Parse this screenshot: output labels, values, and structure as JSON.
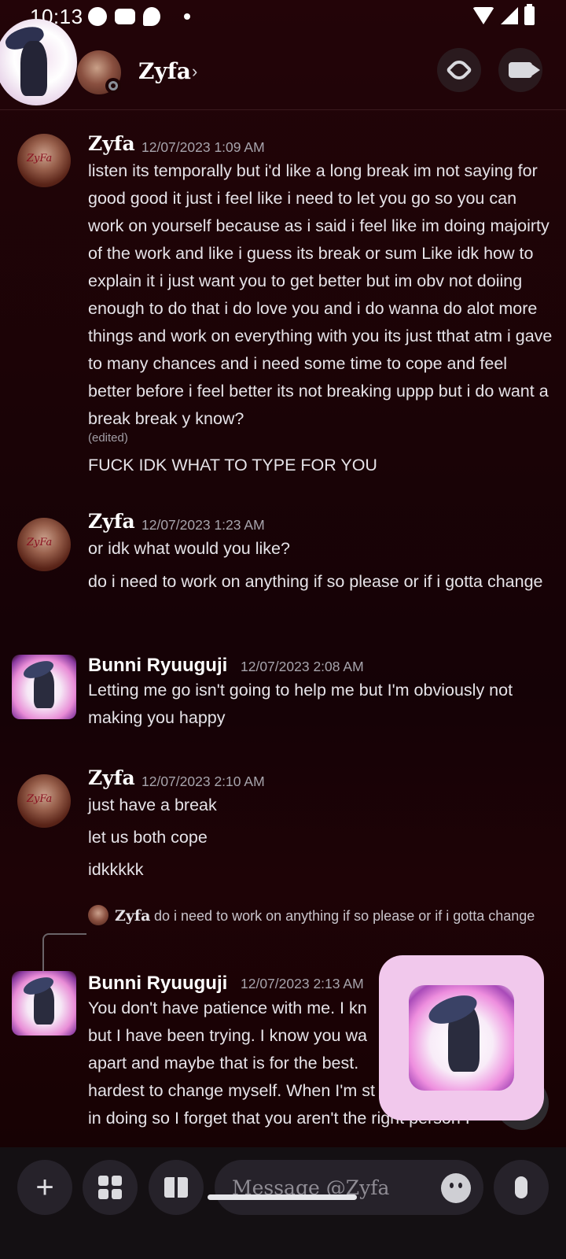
{
  "status_bar": {
    "time": "10:13"
  },
  "header": {
    "title": "Zyfa",
    "chevron": "›",
    "call_icon": "phone-icon",
    "video_icon": "video-icon"
  },
  "messages": [
    {
      "author": "Zyfa",
      "timestamp": "12/07/2023 1:09 AM",
      "lines": [
        "listen its temporally but i'd like a long break im not saying for good good it just i feel like i need to let you go so you can work on yourself because as i said i feel like im doing majoirty of the work and like i guess its break or sum Like idk how to explain it i just want you to get better but im obv not doiing enough to do that i do love you and i do wanna do alot more things and work on everything with you its just tthat atm i gave to many chances and i need some time to cope and feel better before i feel better its not breaking uppp but i do want a break break y know?",
        "FUCK IDK WHAT TO TYPE FOR YOU"
      ],
      "edited": "(edited)"
    },
    {
      "author": "Zyfa",
      "timestamp": "12/07/2023 1:23 AM",
      "lines": [
        "or idk what would you like?",
        "do i need to work on anything if so please or if i gotta change"
      ]
    },
    {
      "author": "Bunni Ryuuguji",
      "timestamp": "12/07/2023 2:08 AM",
      "lines": [
        "Letting me go isn't going to help me but I'm obviously not making you happy"
      ]
    },
    {
      "author": "Zyfa",
      "timestamp": "12/07/2023 2:10 AM",
      "lines": [
        "just have a break",
        "let us both cope",
        "idkkkkk"
      ]
    },
    {
      "reply": {
        "author": "Zyfa",
        "text": "do i need to work on anything if so please or if i gotta change"
      },
      "author": "Bunni Ryuuguji",
      "timestamp": "12/07/2023 2:13 AM",
      "lines": [
        "You don't have patience with me. I kn",
        "but I have been trying. I know you wa",
        "apart and maybe that is for the best.",
        "hardest to change myself. When I'm st",
        "in doing so I forget that you aren't the right person I"
      ]
    }
  ],
  "input": {
    "placeholder": "Message @Zyfa",
    "plus": "+"
  }
}
